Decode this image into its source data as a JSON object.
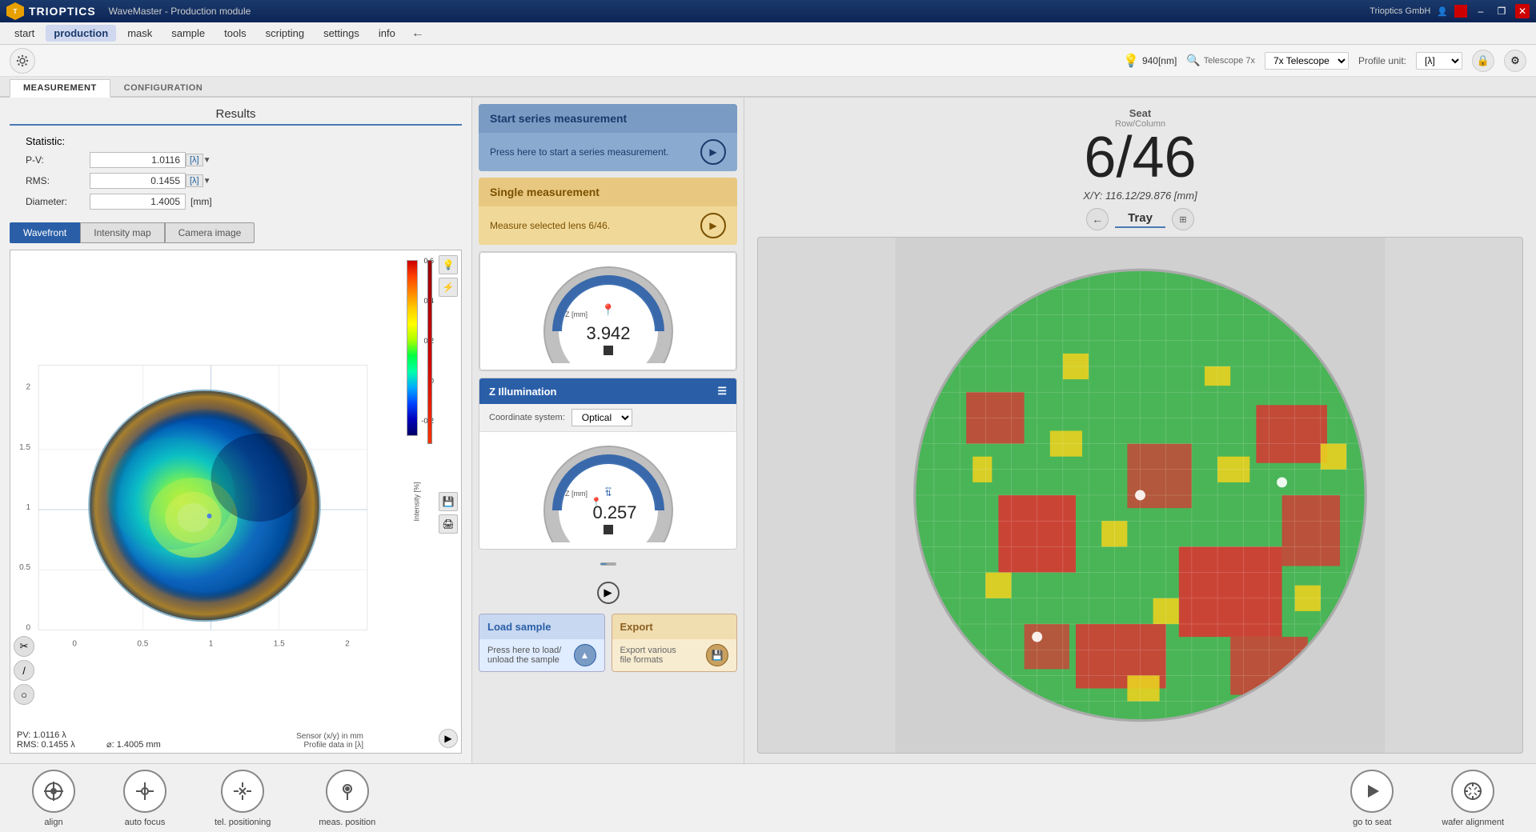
{
  "titlebar": {
    "logo": "T",
    "company": "TRIOPTICS",
    "app_title": "WaveMaster - Production module",
    "user": "Trioptics GmbH",
    "minimize": "–",
    "restore": "❐",
    "close": "✕"
  },
  "menubar": {
    "items": [
      "start",
      "production",
      "mask",
      "sample",
      "tools",
      "scripting",
      "settings",
      "info"
    ],
    "active": "production",
    "back_arrow": "←"
  },
  "toolbar": {
    "wavelength": "940[nm]",
    "telescope_icon": "🔍",
    "telescope_label": "Telescope 7x",
    "telescope_value": "7x Telescope",
    "profile_unit_label": "Profile unit:",
    "profile_unit_value": "[λ]"
  },
  "tabs": {
    "measurement": "MEASUREMENT",
    "configuration": "CONFIGURATION",
    "active": "measurement"
  },
  "results": {
    "title": "Results",
    "statistic_label": "Statistic:",
    "pv_label": "P-V:",
    "pv_value": "1.0116",
    "pv_unit": "[λ]",
    "rms_label": "RMS:",
    "rms_value": "0.1455",
    "rms_unit": "[λ]",
    "diameter_label": "Diameter:",
    "diameter_value": "1.4005",
    "diameter_unit": "[mm]"
  },
  "view_tabs": {
    "wavefront": "Wavefront",
    "intensity_map": "Intensity map",
    "camera_image": "Camera image",
    "active": "wavefront"
  },
  "plot": {
    "x_values": [
      "0",
      "0.5",
      "1",
      "1.5",
      "2"
    ],
    "y_values": [
      "0",
      "0.5",
      "1",
      "1.5",
      "2"
    ],
    "colorbar_values": [
      "0.6",
      "0.4",
      "0.2",
      "0",
      "-0.2"
    ],
    "pv_footer": "PV:    1.0116 λ",
    "rms_footer": "RMS:  0.1455 λ",
    "diameter_footer": "⌀:         1.4005 mm",
    "sensor_info_1": "Sensor (x/y) in mm",
    "sensor_info_2": "Profile data in [λ]"
  },
  "measurement_cards": {
    "series": {
      "title": "Start series measurement",
      "body": "Press here to start a series measurement."
    },
    "single": {
      "title": "Single measurement",
      "body": "Measure selected lens 6/46."
    }
  },
  "z_gauge": {
    "label": "Z",
    "value": "3.942",
    "unit": "[mm]"
  },
  "illumination": {
    "title": "Z  Illumination",
    "coord_label": "Coordinate system:",
    "coord_value": "Optical",
    "z_value": "0.257",
    "z_unit": "[mm]"
  },
  "load_sample": {
    "title": "Load sample",
    "body": "Press here to load/\nunload the sample"
  },
  "export": {
    "title": "Export",
    "body": "Export various\nfile formats"
  },
  "seat": {
    "label": "Seat",
    "sublabel": "Row/Column",
    "value": "6/46",
    "xy_label": "X/Y:",
    "xy_value": "116.12/29.876 [mm]"
  },
  "tray": {
    "label": "Tray"
  },
  "bottom_toolbar": {
    "align": "align",
    "auto_focus": "auto focus",
    "tel_positioning": "tel. positioning",
    "meas_position": "meas. position",
    "go_to_seat": "go to seat",
    "wafer_alignment": "wafer alignment"
  },
  "tray_colors": {
    "green": "#3cb34a",
    "red": "#e03030",
    "yellow": "#e8d020",
    "gray": "#b8b8b8",
    "white_dot": "#ffffff"
  }
}
